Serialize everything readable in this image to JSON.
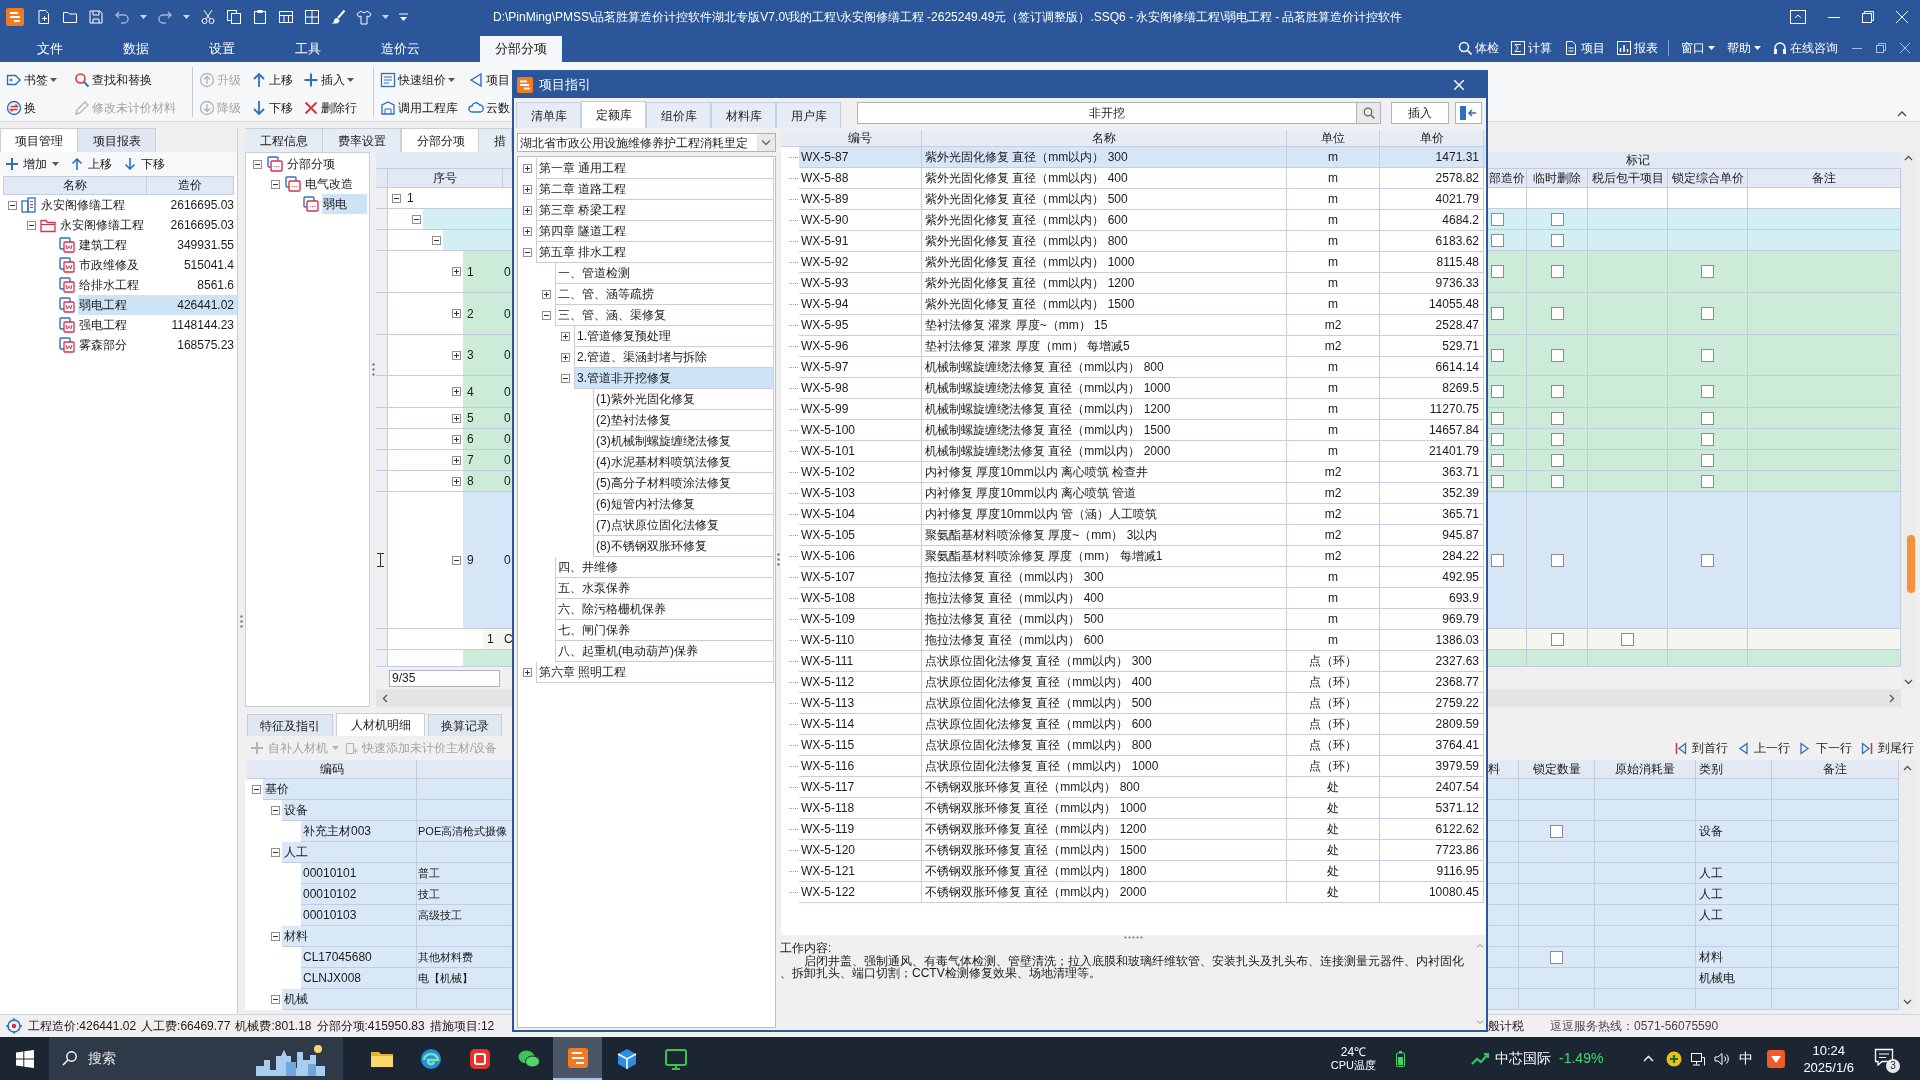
{
  "window": {
    "title": "D:\\PinMing\\PMSS\\品茗胜算造价计控软件湖北专版V7.0\\我的工程\\永安阁修缮工程 -2625249.49元（签订调整版）.SSQ6 - 永安阁修缮工程\\弱电工程 - 品茗胜算造价计控软件"
  },
  "menu": {
    "tabs": [
      {
        "label": "文件",
        "selected": false
      },
      {
        "label": "数据",
        "selected": false
      },
      {
        "label": "设置",
        "selected": false
      },
      {
        "label": "工具",
        "selected": false
      },
      {
        "label": "造价云",
        "selected": false
      },
      {
        "label": "分部分项",
        "selected": true
      }
    ],
    "tools": [
      {
        "label": "体检"
      },
      {
        "label": "计算"
      },
      {
        "label": "项目"
      },
      {
        "label": "报表",
        "divider_after": true
      },
      {
        "label": "窗口",
        "dropdown": true
      },
      {
        "label": "帮助",
        "dropdown": true
      },
      {
        "label": "在线咨询"
      }
    ]
  },
  "toolbar": {
    "columns": [
      {
        "items": [
          {
            "label": "书签",
            "dropdown": true,
            "disabled": false
          },
          {
            "label": "换",
            "disabled": false
          }
        ]
      },
      {
        "items": [
          {
            "label": "查找和替换",
            "disabled": false
          },
          {
            "label": "修改未计价材料",
            "disabled": true
          }
        ],
        "divider_after": true
      },
      {
        "items": [
          {
            "label": "升级",
            "disabled": true
          },
          {
            "label": "降级",
            "disabled": true
          }
        ]
      },
      {
        "items": [
          {
            "label": "上移",
            "disabled": false
          },
          {
            "label": "下移",
            "disabled": false
          }
        ]
      },
      {
        "items": [
          {
            "label": "插入",
            "dropdown": true,
            "disabled": false
          },
          {
            "label": "删除行",
            "disabled": false
          }
        ],
        "divider_after": true
      },
      {
        "items": [
          {
            "label": "快速组价",
            "dropdown": true,
            "disabled": false
          },
          {
            "label": "调用工程库",
            "disabled": false
          }
        ]
      },
      {
        "items": [
          {
            "label": "项目",
            "disabled": false
          },
          {
            "label": "云数",
            "disabled": false
          }
        ]
      }
    ]
  },
  "left_panel": {
    "tabs": [
      {
        "label": "项目管理",
        "selected": true
      },
      {
        "label": "项目报表",
        "selected": false
      }
    ],
    "toolbar": [
      {
        "label": "增加",
        "dropdown": true
      },
      {
        "label": "上移"
      },
      {
        "label": "下移"
      }
    ],
    "columns": [
      "名称",
      "造价"
    ],
    "tree": [
      {
        "kind": "project",
        "name": "永安阁修缮工程",
        "cost": "2616695.03",
        "expanded": true,
        "selected": false,
        "children": [
          {
            "kind": "folder",
            "name": "永安阁修缮工程",
            "cost": "2616695.03",
            "expanded": true,
            "selected": false,
            "children": [
              {
                "kind": "unit",
                "name": "建筑工程",
                "cost": "349931.55",
                "selected": false
              },
              {
                "kind": "unit",
                "name": "市政维修及",
                "cost": "515041.4",
                "selected": false
              },
              {
                "kind": "unit",
                "name": "给排水工程",
                "cost": "8561.6",
                "selected": false
              },
              {
                "kind": "unit",
                "name": "弱电工程",
                "cost": "426441.02",
                "selected": true
              },
              {
                "kind": "unit",
                "name": "强电工程",
                "cost": "1148144.23",
                "selected": false
              },
              {
                "kind": "unit",
                "name": "雾森部分",
                "cost": "168575.23",
                "selected": false
              }
            ]
          }
        ]
      }
    ]
  },
  "project_tabs": [
    {
      "label": "工程信息",
      "selected": false
    },
    {
      "label": "费率设置",
      "selected": false
    },
    {
      "label": "分部分项",
      "selected": true
    },
    {
      "label": "措",
      "selected": false
    }
  ],
  "section_tree": [
    {
      "name": "分部分项",
      "expanded": true,
      "selected": false,
      "children": [
        {
          "name": "电气改造",
          "expanded": true,
          "selected": false,
          "children": [
            {
              "name": "弱电",
              "selected": true
            }
          ]
        }
      ]
    }
  ],
  "main_grid": {
    "group_header": "标记",
    "columns": [
      "序号",
      "部造价",
      "临时删除",
      "税后包干项目",
      "锁定综合单价",
      "备注"
    ],
    "rows": [
      {
        "kind": "unit",
        "number": "1",
        "expanded": true,
        "selected": false,
        "children": [
          {
            "kind": "section",
            "expanded": true,
            "selected": false,
            "column_1_checked": false,
            "temp_delete_checked": false,
            "children": [
              {
                "kind": "section",
                "expanded": true,
                "selected": false,
                "column_1_checked": false,
                "temp_delete_checked": false,
                "children": [
                  {
                    "kind": "item",
                    "number": "1",
                    "code": "0",
                    "expanded": false,
                    "selected": false,
                    "column_1_checked": false,
                    "temp_delete_checked": false,
                    "lock_price_checked": false
                  },
                  {
                    "kind": "item",
                    "number": "2",
                    "code": "0",
                    "expanded": false,
                    "selected": false,
                    "column_1_checked": false,
                    "temp_delete_checked": false,
                    "lock_price_checked": false
                  },
                  {
                    "kind": "item",
                    "number": "3",
                    "code": "0",
                    "expanded": false,
                    "selected": false,
                    "column_1_checked": false,
                    "temp_delete_checked": false,
                    "lock_price_checked": false
                  },
                  {
                    "kind": "item",
                    "number": "4",
                    "code": "0",
                    "expanded": false,
                    "selected": false,
                    "column_1_checked": false,
                    "temp_delete_checked": false,
                    "lock_price_checked": false
                  },
                  {
                    "kind": "item",
                    "number": "5",
                    "code": "0",
                    "expanded": false,
                    "selected": false,
                    "column_1_checked": false,
                    "temp_delete_checked": false,
                    "lock_price_checked": false
                  },
                  {
                    "kind": "item",
                    "number": "6",
                    "code": "0",
                    "expanded": false,
                    "selected": false,
                    "column_1_checked": false,
                    "temp_delete_checked": false,
                    "lock_price_checked": false
                  },
                  {
                    "kind": "item",
                    "number": "7",
                    "code": "0",
                    "expanded": false,
                    "selected": false,
                    "column_1_checked": false,
                    "temp_delete_checked": false,
                    "lock_price_checked": false
                  },
                  {
                    "kind": "item",
                    "number": "8",
                    "code": "0",
                    "expanded": false,
                    "selected": false,
                    "column_1_checked": false,
                    "temp_delete_checked": false,
                    "lock_price_checked": false
                  },
                  {
                    "kind": "item",
                    "number": "9",
                    "code": "0",
                    "expanded": true,
                    "selected": true,
                    "column_1_checked": false,
                    "temp_delete_checked": false,
                    "lock_price_checked": false,
                    "children": [
                      {
                        "kind": "sub",
                        "number": "1",
                        "code": "C",
                        "selected": false,
                        "temp_delete_checked": false,
                        "after_tax_checked": false
                      }
                    ]
                  },
                  {
                    "kind": "item",
                    "selected": false
                  }
                ]
              }
            ]
          }
        ]
      }
    ],
    "row_counter": "9/35"
  },
  "detail_panel": {
    "tabs": [
      {
        "label": "特征及指引",
        "selected": false
      },
      {
        "label": "人材机明细",
        "selected": true
      },
      {
        "label": "换算记录",
        "selected": false
      }
    ],
    "toolbar": [
      {
        "label": "自补人材机",
        "dropdown": true,
        "disabled": true
      },
      {
        "label": "快速添加未计价主材/设备",
        "disabled": true
      }
    ],
    "navigation": [
      {
        "label": "到首行"
      },
      {
        "label": "上一行"
      },
      {
        "label": "下一行"
      },
      {
        "label": "到尾行"
      }
    ],
    "columns": [
      "编码",
      "料",
      "锁定数量",
      "原始消耗量",
      "类别",
      "备注"
    ],
    "rows": [
      {
        "code": "基价",
        "expanded": true,
        "children": [
          {
            "code": "设备",
            "expanded": true,
            "children": [
              {
                "code": "补充主材003",
                "name": "POE高清枪式摄像",
                "category": "设备",
                "lock_qty_checked": false
              }
            ]
          },
          {
            "code": "人工",
            "expanded": true,
            "children": [
              {
                "code": "00010101",
                "name": "普工",
                "category": "人工"
              },
              {
                "code": "00010102",
                "name": "技工",
                "category": "人工"
              },
              {
                "code": "00010103",
                "name": "高级技工",
                "category": "人工"
              }
            ]
          },
          {
            "code": "材料",
            "expanded": true,
            "children": [
              {
                "code": "CL17045680",
                "name": "其他材料费",
                "category": "材料",
                "lock_qty_checked": false
              },
              {
                "code": "CLNJX008",
                "name": "电【机械】",
                "category": "机械电"
              }
            ]
          },
          {
            "code": "机械",
            "expanded": true
          }
        ]
      }
    ]
  },
  "dialog": {
    "title": "项目指引",
    "tabs": [
      {
        "label": "清单库",
        "selected": false
      },
      {
        "label": "定额库",
        "selected": true
      },
      {
        "label": "组价库",
        "selected": false
      },
      {
        "label": "材料库",
        "selected": false
      },
      {
        "label": "用户库",
        "selected": false
      }
    ],
    "search": {
      "value": "非开挖"
    },
    "insert_button": "插入",
    "library": "湖北省市政公用设施维修养护工程消耗里定",
    "tree": [
      {
        "label": "第一章 通用工程",
        "expanded": false,
        "selected": false
      },
      {
        "label": "第二章 道路工程",
        "expanded": false,
        "selected": false
      },
      {
        "label": "第三章 桥梁工程",
        "expanded": false,
        "selected": false
      },
      {
        "label": "第四章 隧道工程",
        "expanded": false,
        "selected": false
      },
      {
        "label": "第五章 排水工程",
        "expanded": true,
        "selected": false,
        "children": [
          {
            "label": "一、管道检测",
            "selected": false
          },
          {
            "label": "二、管、涵等疏捞",
            "expanded": false,
            "selected": false
          },
          {
            "label": "三、管、涵、渠修复",
            "expanded": true,
            "selected": false,
            "children": [
              {
                "label": "1.管道修复预处理",
                "expanded": false,
                "selected": false
              },
              {
                "label": "2.管道、渠涵封堵与拆除",
                "expanded": false,
                "selected": false
              },
              {
                "label": "3.管道非开挖修复",
                "expanded": true,
                "selected": true,
                "children": [
                  {
                    "label": "(1)紫外光固化修复",
                    "selected": false
                  },
                  {
                    "label": "(2)垫衬法修复",
                    "selected": false
                  },
                  {
                    "label": "(3)机械制螺旋缠绕法修复",
                    "selected": false
                  },
                  {
                    "label": "(4)水泥基材料喷筑法修复",
                    "selected": false
                  },
                  {
                    "label": "(5)高分子材料喷涂法修复",
                    "selected": false
                  },
                  {
                    "label": "(6)短管内衬法修复",
                    "selected": false
                  },
                  {
                    "label": "(7)点状原位固化法修复",
                    "selected": false
                  },
                  {
                    "label": "(8)不锈钢双胀环修复",
                    "selected": false
                  }
                ]
              }
            ]
          },
          {
            "label": "四、井维修",
            "selected": false
          },
          {
            "label": "五、水泵保养",
            "selected": false
          },
          {
            "label": "六、除污格栅机保养",
            "selected": false
          },
          {
            "label": "七、闸门保养",
            "selected": false
          },
          {
            "label": "八、起重机(电动葫芦)保养",
            "selected": false
          }
        ]
      },
      {
        "label": "第六章 照明工程",
        "expanded": false,
        "selected": false
      }
    ],
    "table": {
      "columns": [
        "编号",
        "名称",
        "单位",
        "单价"
      ],
      "rows": [
        {
          "code": "WX-5-87",
          "name": "紫外光固化修复 直径（mm以内） 300",
          "unit": "m",
          "price": "1471.31",
          "selected": true
        },
        {
          "code": "WX-5-88",
          "name": "紫外光固化修复 直径（mm以内） 400",
          "unit": "m",
          "price": "2578.82",
          "selected": false
        },
        {
          "code": "WX-5-89",
          "name": "紫外光固化修复 直径（mm以内） 500",
          "unit": "m",
          "price": "4021.79",
          "selected": false
        },
        {
          "code": "WX-5-90",
          "name": "紫外光固化修复 直径（mm以内） 600",
          "unit": "m",
          "price": "4684.2",
          "selected": false
        },
        {
          "code": "WX-5-91",
          "name": "紫外光固化修复 直径（mm以内） 800",
          "unit": "m",
          "price": "6183.62",
          "selected": false
        },
        {
          "code": "WX-5-92",
          "name": "紫外光固化修复 直径（mm以内） 1000",
          "unit": "m",
          "price": "8115.48",
          "selected": false
        },
        {
          "code": "WX-5-93",
          "name": "紫外光固化修复 直径（mm以内） 1200",
          "unit": "m",
          "price": "9736.33",
          "selected": false
        },
        {
          "code": "WX-5-94",
          "name": "紫外光固化修复 直径（mm以内） 1500",
          "unit": "m",
          "price": "14055.48",
          "selected": false
        },
        {
          "code": "WX-5-95",
          "name": "垫衬法修复 灌浆 厚度~（mm） 15",
          "unit": "m2",
          "price": "2528.47",
          "selected": false
        },
        {
          "code": "WX-5-96",
          "name": "垫衬法修复 灌浆 厚度（mm） 每增减5",
          "unit": "m2",
          "price": "529.71",
          "selected": false
        },
        {
          "code": "WX-5-97",
          "name": "机械制螺旋缠绕法修复 直径（mm以内） 800",
          "unit": "m",
          "price": "6614.14",
          "selected": false
        },
        {
          "code": "WX-5-98",
          "name": "机械制螺旋缠绕法修复 直径（mm以内） 1000",
          "unit": "m",
          "price": "8269.5",
          "selected": false
        },
        {
          "code": "WX-5-99",
          "name": "机械制螺旋缠绕法修复 直径（mm以内） 1200",
          "unit": "m",
          "price": "11270.75",
          "selected": false
        },
        {
          "code": "WX-5-100",
          "name": "机械制螺旋缠绕法修复 直径（mm以内） 1500",
          "unit": "m",
          "price": "14657.84",
          "selected": false
        },
        {
          "code": "WX-5-101",
          "name": "机械制螺旋缠绕法修复 直径（mm以内） 2000",
          "unit": "m",
          "price": "21401.79",
          "selected": false
        },
        {
          "code": "WX-5-102",
          "name": "内衬修复 厚度10mm以内 离心喷筑 检查井",
          "unit": "m2",
          "price": "363.71",
          "selected": false
        },
        {
          "code": "WX-5-103",
          "name": "内衬修复 厚度10mm以内 离心喷筑 管道",
          "unit": "m2",
          "price": "352.39",
          "selected": false
        },
        {
          "code": "WX-5-104",
          "name": "内衬修复 厚度10mm以内 管（涵）人工喷筑",
          "unit": "m2",
          "price": "365.71",
          "selected": false
        },
        {
          "code": "WX-5-105",
          "name": "聚氨酯基材料喷涂修复 厚度~（mm） 3以内",
          "unit": "m2",
          "price": "945.87",
          "selected": false
        },
        {
          "code": "WX-5-106",
          "name": "聚氨酯基材料喷涂修复 厚度（mm） 每增减1",
          "unit": "m2",
          "price": "284.22",
          "selected": false
        },
        {
          "code": "WX-5-107",
          "name": "拖拉法修复 直径（mm以内） 300",
          "unit": "m",
          "price": "492.95",
          "selected": false
        },
        {
          "code": "WX-5-108",
          "name": "拖拉法修复 直径（mm以内） 400",
          "unit": "m",
          "price": "693.9",
          "selected": false
        },
        {
          "code": "WX-5-109",
          "name": "拖拉法修复 直径（mm以内） 500",
          "unit": "m",
          "price": "969.79",
          "selected": false
        },
        {
          "code": "WX-5-110",
          "name": "拖拉法修复 直径（mm以内） 600",
          "unit": "m",
          "price": "1386.03",
          "selected": false
        },
        {
          "code": "WX-5-111",
          "name": "点状原位固化法修复 直径（mm以内） 300",
          "unit": "点（环）",
          "price": "2327.63",
          "selected": false
        },
        {
          "code": "WX-5-112",
          "name": "点状原位固化法修复 直径（mm以内） 400",
          "unit": "点（环）",
          "price": "2368.77",
          "selected": false
        },
        {
          "code": "WX-5-113",
          "name": "点状原位固化法修复 直径（mm以内） 500",
          "unit": "点（环）",
          "price": "2759.22",
          "selected": false
        },
        {
          "code": "WX-5-114",
          "name": "点状原位固化法修复 直径（mm以内） 600",
          "unit": "点（环）",
          "price": "2809.59",
          "selected": false
        },
        {
          "code": "WX-5-115",
          "name": "点状原位固化法修复 直径（mm以内） 800",
          "unit": "点（环）",
          "price": "3764.41",
          "selected": false
        },
        {
          "code": "WX-5-116",
          "name": "点状原位固化法修复 直径（mm以内） 1000",
          "unit": "点（环）",
          "price": "3979.59",
          "selected": false
        },
        {
          "code": "WX-5-117",
          "name": "不锈钢双胀环修复 直径（mm以内） 800",
          "unit": "处",
          "price": "2407.54",
          "selected": false
        },
        {
          "code": "WX-5-118",
          "name": "不锈钢双胀环修复 直径（mm以内） 1000",
          "unit": "处",
          "price": "5371.12",
          "selected": false
        },
        {
          "code": "WX-5-119",
          "name": "不锈钢双胀环修复 直径（mm以内） 1200",
          "unit": "处",
          "price": "6122.62",
          "selected": false
        },
        {
          "code": "WX-5-120",
          "name": "不锈钢双胀环修复 直径（mm以内） 1500",
          "unit": "处",
          "price": "7723.86",
          "selected": false
        },
        {
          "code": "WX-5-121",
          "name": "不锈钢双胀环修复 直径（mm以内） 1800",
          "unit": "处",
          "price": "9116.95",
          "selected": false
        },
        {
          "code": "WX-5-122",
          "name": "不锈钢双胀环修复 直径（mm以内） 2000",
          "unit": "处",
          "price": "10080.45",
          "selected": false
        }
      ]
    },
    "work_content": {
      "label": "工作内容:",
      "text": "启闭井盖、强制通风、有毒气体检测、管壁清洗；拉入底膜和玻璃纤维软管、安装扎头及扎头布、连接测量元器件、内衬固化、拆卸扎头、端口切割；CCTV检测修复效果、场地清理等。"
    }
  },
  "status_bar": {
    "items": [
      "工程造价:426441.02",
      "人工费:66469.77",
      "机械费:801.18",
      "分部分项:415950.83",
      "措施项目:12"
    ],
    "tax_mode": "般计税",
    "hotline": "逗逗服务热线：0571-56075590"
  },
  "taskbar": {
    "search": {
      "placeholder": "搜索"
    },
    "apps": [
      {
        "kind": "files",
        "active": false
      },
      {
        "kind": "browser",
        "active": false
      },
      {
        "kind": "office",
        "active": false
      },
      {
        "kind": "chat",
        "active": false
      },
      {
        "kind": "estimator",
        "active": true
      },
      {
        "kind": "cube",
        "active": false
      },
      {
        "kind": "terminal",
        "active": false
      }
    ],
    "temperature": "24℃",
    "sensor_label": "CPU温度",
    "stock": {
      "name": "中芯国际",
      "change": "-1.49%"
    },
    "ime": "中",
    "time": "10:24",
    "date": "2025/1/6",
    "notifications": "3"
  }
}
